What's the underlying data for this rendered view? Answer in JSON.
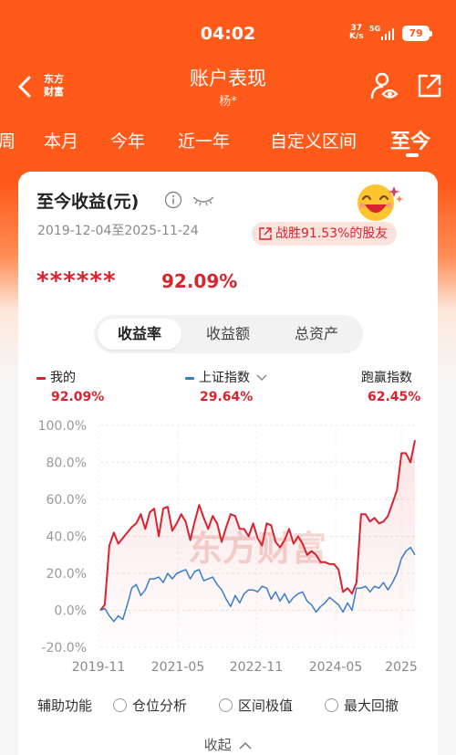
{
  "status_bar": {
    "time": "04:02",
    "net_speed_top": "37",
    "net_speed_unit": "K/s",
    "network": "5G",
    "battery": "79"
  },
  "header": {
    "logo_line1": "东方",
    "logo_line2": "财富",
    "title": "账户表现",
    "subtitle": "杨*"
  },
  "tabs": [
    {
      "label": "周"
    },
    {
      "label": "本月"
    },
    {
      "label": "今年"
    },
    {
      "label": "近一年"
    },
    {
      "label": "自定义区间"
    },
    {
      "label": "至今",
      "active": true
    }
  ],
  "card": {
    "title": "至今收益(元)",
    "date_range": "2019-12-04至2025-11-24",
    "beat_text": "战胜91.53%的股友",
    "masked_amount": "******",
    "return_pct": "92.09%",
    "segments": [
      {
        "label": "收益率",
        "active": true
      },
      {
        "label": "收益额"
      },
      {
        "label": "总资产"
      }
    ],
    "legend": [
      {
        "name": "我的",
        "value": "92.09%",
        "color": "#d9232e"
      },
      {
        "name": "上证指数",
        "value": "29.64%",
        "color": "#3a7dc9"
      },
      {
        "name": "跑赢指数",
        "value": "62.45%"
      }
    ]
  },
  "chart_data": {
    "type": "line",
    "x_tick_labels": [
      "2019-11",
      "2021-05",
      "2022-11",
      "2024-05",
      "2025"
    ],
    "y_tick_labels": [
      "100.0%",
      "80.0%",
      "60.0%",
      "40.0%",
      "20.0%",
      "0.0%",
      "-20.0%"
    ],
    "ylim": [
      -20,
      100
    ],
    "watermark": "东方财富",
    "series": [
      {
        "name": "我的",
        "color": "#d9232e",
        "values": [
          0,
          3,
          35,
          42,
          36,
          39,
          42,
          45,
          47,
          52,
          44,
          53,
          55,
          40,
          55,
          56,
          43,
          47,
          52,
          48,
          38,
          48,
          57,
          50,
          44,
          51,
          47,
          37,
          45,
          52,
          51,
          44,
          44,
          40,
          47,
          39,
          35,
          47,
          46,
          37,
          34,
          38,
          44,
          36,
          40,
          36,
          30,
          32,
          30,
          26,
          26,
          25,
          25,
          22,
          10,
          12,
          9,
          15,
          52,
          52,
          48,
          50,
          47,
          48,
          51,
          58,
          65,
          85,
          85,
          80,
          92
        ]
      },
      {
        "name": "上证指数",
        "color": "#3a7dc9",
        "values": [
          0,
          1,
          -3,
          -6,
          -3,
          -5,
          3,
          12,
          14,
          8,
          11,
          17,
          17,
          18,
          15,
          20,
          17,
          20,
          21,
          22,
          17,
          21,
          22,
          16,
          17,
          18,
          14,
          11,
          6,
          2,
          8,
          4,
          9,
          11,
          11,
          10,
          13,
          12,
          6,
          10,
          5,
          9,
          4,
          7,
          9,
          10,
          5,
          3,
          -1,
          2,
          4,
          7,
          5,
          3,
          -1,
          4,
          0,
          12,
          12,
          13,
          10,
          13,
          12,
          15,
          11,
          15,
          20,
          28,
          32,
          34,
          30
        ]
      }
    ]
  },
  "bottom": {
    "aux_label": "辅助功能",
    "options": [
      {
        "label": "仓位分析"
      },
      {
        "label": "区间极值"
      },
      {
        "label": "最大回撤"
      }
    ],
    "collapse_label": "收起"
  },
  "colors": {
    "brand": "#ff5a19",
    "up": "#d9232e",
    "index": "#3a7dc9"
  }
}
